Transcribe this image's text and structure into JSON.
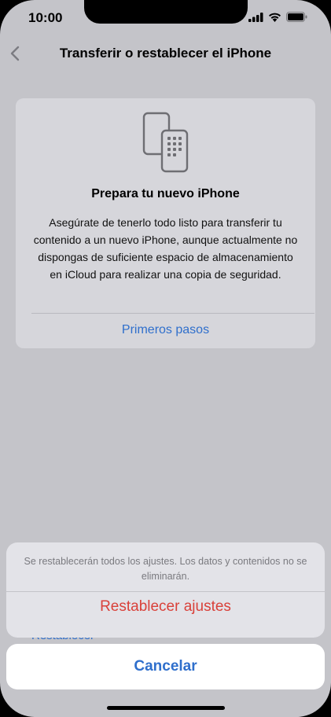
{
  "status_bar": {
    "time": "10:00",
    "icons": [
      "signal-icon",
      "wifi-icon",
      "battery-icon"
    ]
  },
  "nav": {
    "back_icon": "chevron-left-icon",
    "title": "Transferir o restablecer el iPhone"
  },
  "card": {
    "icon": "two-phones-icon",
    "title": "Prepara tu nuevo iPhone",
    "body": "Asegúrate de tenerlo todo listo para transferir tu contenido a un nuevo iPhone, aunque actualmente no dispongas de suficiente espacio de almacenamiento en iCloud para realizar una copia de seguridad.",
    "link": "Primeros pasos"
  },
  "behind_list": {
    "partial_item": "Restablecer"
  },
  "action_sheet": {
    "message": "Se restablecerán todos los ajustes. Los datos y contenidos no se eliminarán.",
    "action": "Restablecer ajustes",
    "cancel": "Cancelar"
  },
  "colors": {
    "accent": "#2f6fcc",
    "destructive": "#d9413a",
    "dim_background": "#c4c4c9"
  }
}
